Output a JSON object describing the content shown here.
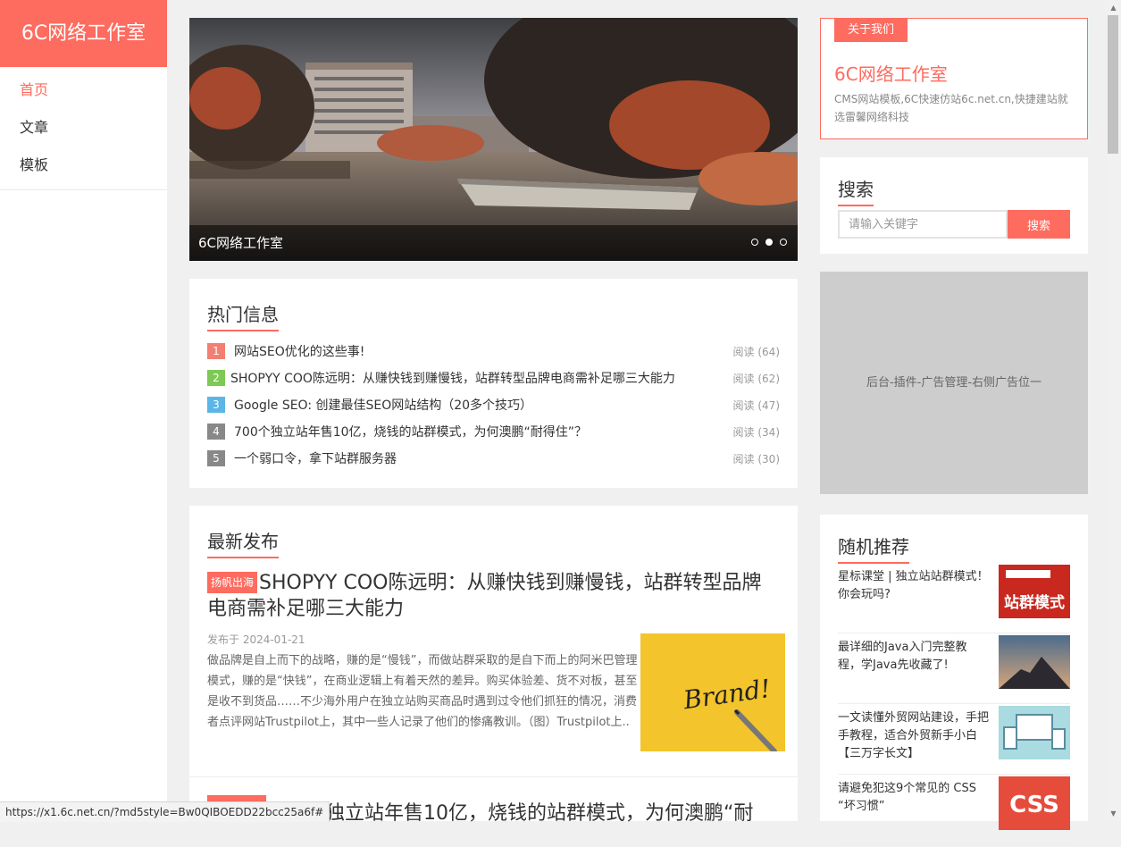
{
  "site": {
    "logo": "6C网络工作室"
  },
  "nav": {
    "items": [
      {
        "label": "首页"
      },
      {
        "label": "文章"
      },
      {
        "label": "模板"
      }
    ]
  },
  "slider": {
    "caption": "6C网络工作室",
    "dot_count": 3,
    "active_dot": 2
  },
  "hot": {
    "title": "热门信息",
    "items": [
      {
        "rank": "1",
        "title": "网站SEO优化的这些事!",
        "views": "阅读 (64)",
        "color": "#f27f71"
      },
      {
        "rank": "2",
        "title": "SHOPYY COO陈远明：从赚快钱到赚慢钱，站群转型品牌电商需补足哪三大能力",
        "views": "阅读 (62)",
        "color": "#7ec954"
      },
      {
        "rank": "3",
        "title": "Google SEO: 创建最佳SEO网站结构（20多个技巧）",
        "views": "阅读 (47)",
        "color": "#5bb5e6"
      },
      {
        "rank": "4",
        "title": "700个独立站年售10亿，烧钱的站群模式，为何澳鹏“耐得住”？",
        "views": "阅读 (34)",
        "color": "#888888"
      },
      {
        "rank": "5",
        "title": "一个弱口令，拿下站群服务器",
        "views": "阅读 (30)",
        "color": "#888888"
      }
    ]
  },
  "latest": {
    "title": "最新发布",
    "post": {
      "tag": "扬帆出海",
      "title": "SHOPYY COO陈远明：从赚快钱到赚慢钱，站群转型品牌电商需补足哪三大能力",
      "date": "发布于 2024-01-21",
      "excerpt": "做品牌是自上而下的战略，赚的是“慢钱”，而做站群采取的是自下而上的阿米巴管理模式，赚的是“快钱”，在商业逻辑上有着天然的差异。购买体验差、货不对板，甚至是收不到货品……不少海外用户在独立站购买商品时遇到过令他们抓狂的情况，消费者点评网站Trustpilot上，其中一些人记录了他们的惨痛教训。（图）Trustpilot上..",
      "thumb_text": "Brand!"
    },
    "post2": {
      "title": "700个独立站年售10亿，烧钱的站群模式，为何澳鹏“耐"
    }
  },
  "about": {
    "tag": "关于我们",
    "name": "6C网络工作室",
    "desc": "CMS网站模板,6C快速仿站6c.net.cn,快捷建站就选雷馨网络科技"
  },
  "search": {
    "title": "搜索",
    "placeholder": "请输入关键字",
    "button": "搜索"
  },
  "ad": {
    "text": "后台-插件-广告管理-右侧广告位一"
  },
  "random": {
    "title": "随机推荐",
    "items": [
      {
        "title": "星标课堂 | 独立站站群模式！你会玩吗?",
        "thumb_text": "站群模式"
      },
      {
        "title": "最详细的Java入门完整教程，学Java先收藏了!"
      },
      {
        "title": "一文读懂外贸网站建设，手把手教程，适合外贸新手小白【三万字长文】"
      },
      {
        "title": "请避免犯这9个常见的 CSS “坏习惯”",
        "thumb_text": "CSS"
      }
    ]
  },
  "status": {
    "url": "https://x1.6c.net.cn/?md5style=Bw0QIBOEDD22bcc25a6f#"
  },
  "colors": {
    "accent": "#fe6b5f"
  }
}
